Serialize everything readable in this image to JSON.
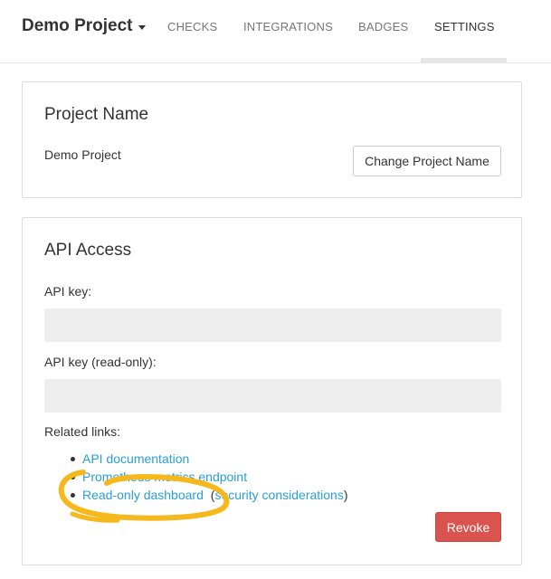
{
  "navbar": {
    "brand": "Demo Project",
    "tabs": [
      {
        "label": "CHECKS"
      },
      {
        "label": "INTEGRATIONS"
      },
      {
        "label": "BADGES"
      },
      {
        "label": "SETTINGS",
        "active": true
      }
    ]
  },
  "project_name_panel": {
    "title": "Project Name",
    "value": "Demo Project",
    "change_button": "Change Project Name"
  },
  "api_access_panel": {
    "title": "API Access",
    "api_key_label": "API key:",
    "api_key_value": "",
    "api_key_readonly_label": "API key (read-only):",
    "api_key_readonly_value": "",
    "related_links_label": "Related links:",
    "links": {
      "api_docs": "API documentation",
      "prometheus": "Prometheus metrics endpoint",
      "readonly_dashboard": "Read-only dashboard",
      "open_paren": "(",
      "security": "security considerations",
      "close_paren": ")"
    },
    "revoke_button": "Revoke"
  },
  "colors": {
    "link": "#2a9fd6",
    "danger": "#d9534f",
    "annotation_highlight": "#f6b81c"
  }
}
